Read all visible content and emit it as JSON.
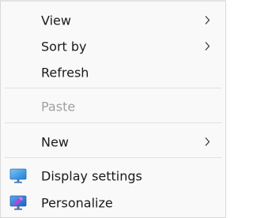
{
  "menu": {
    "items": [
      {
        "label": "View",
        "has_submenu": true,
        "enabled": true
      },
      {
        "label": "Sort by",
        "has_submenu": true,
        "enabled": true
      },
      {
        "label": "Refresh",
        "has_submenu": false,
        "enabled": true
      },
      {
        "label": "Paste",
        "has_submenu": false,
        "enabled": false
      },
      {
        "label": "New",
        "has_submenu": true,
        "enabled": true
      },
      {
        "label": "Display settings",
        "has_submenu": false,
        "enabled": true,
        "icon": "display-monitor-icon"
      },
      {
        "label": "Personalize",
        "has_submenu": false,
        "enabled": true,
        "icon": "personalize-monitor-icon"
      }
    ]
  },
  "colors": {
    "menu_background": "#f9f9f9",
    "text": "#1a1a1a",
    "disabled_text": "#a0a0a0",
    "separator": "#e1e1e1",
    "accent_blue": "#2e8fe0",
    "accent_purple": "#c23fd6"
  }
}
